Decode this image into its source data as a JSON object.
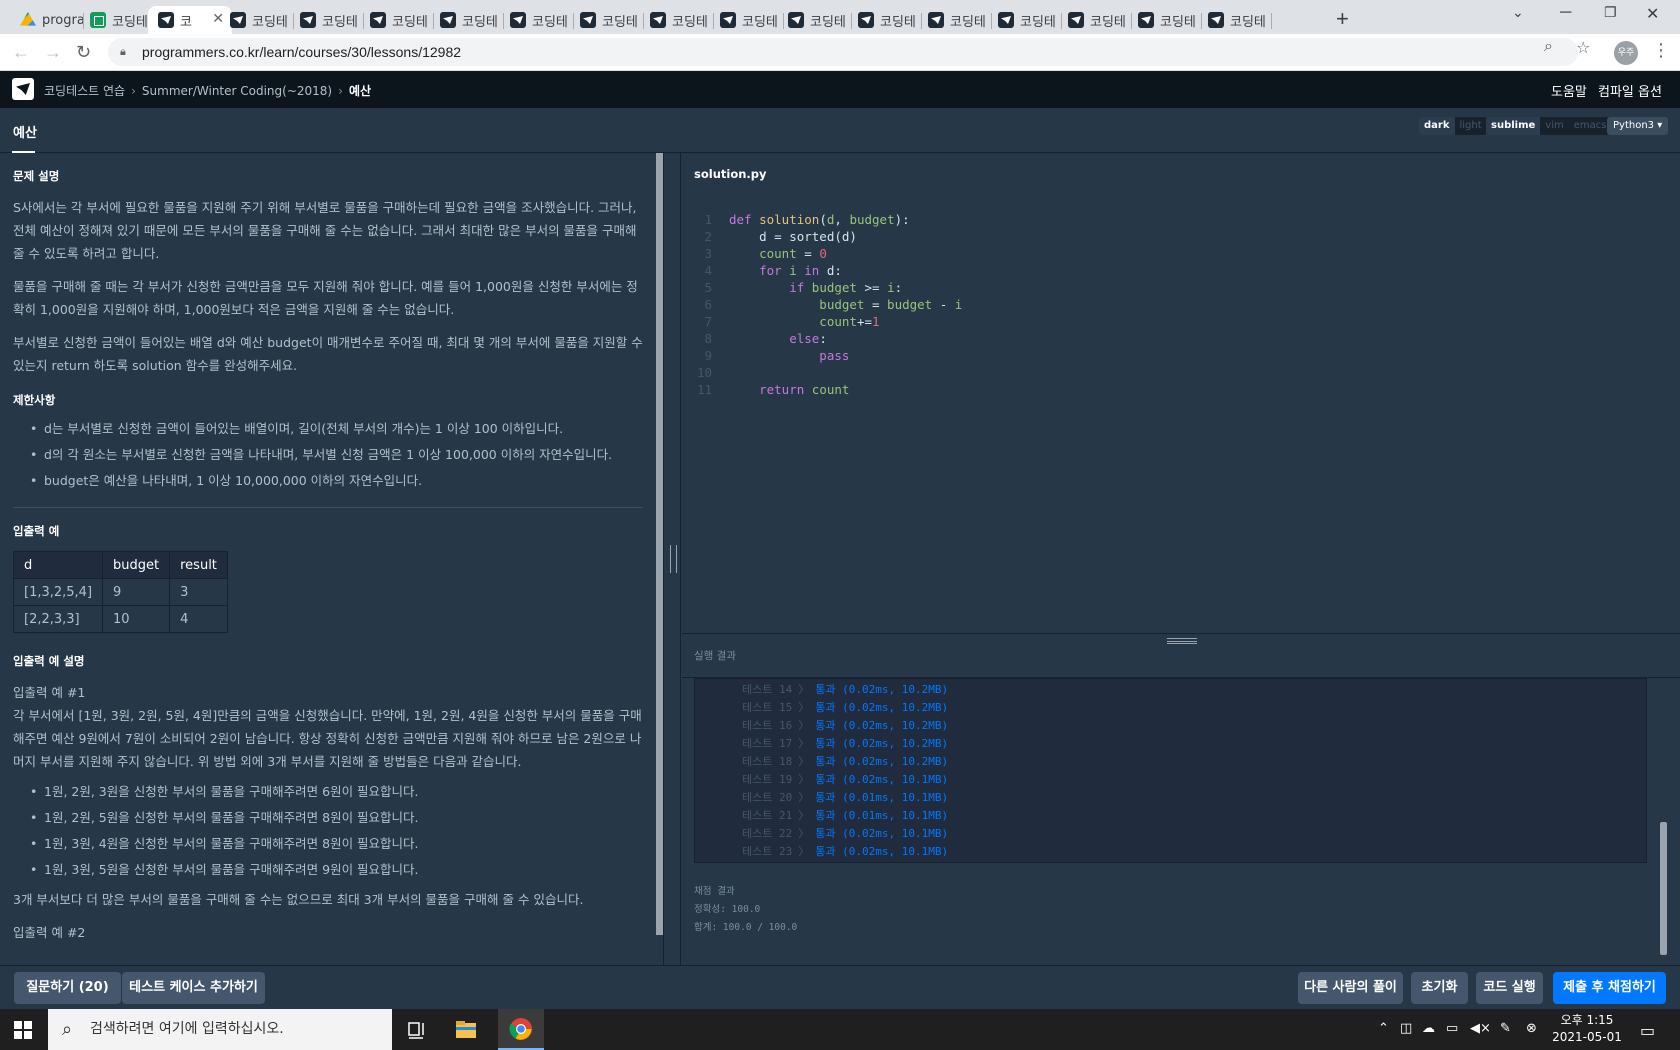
{
  "browser": {
    "tabs": [
      {
        "label": "progra",
        "icon": "drive"
      },
      {
        "label": "코딩테",
        "icon": "sheet"
      },
      {
        "label": "코",
        "icon": "pg",
        "active": true
      },
      {
        "label": "코딩테",
        "icon": "pg"
      },
      {
        "label": "코딩테",
        "icon": "pg"
      },
      {
        "label": "코딩테",
        "icon": "pg"
      },
      {
        "label": "코딩테",
        "icon": "pg"
      },
      {
        "label": "코딩테",
        "icon": "pg"
      },
      {
        "label": "코딩테",
        "icon": "pg"
      },
      {
        "label": "코딩테",
        "icon": "pg"
      },
      {
        "label": "코딩테",
        "icon": "pg"
      },
      {
        "label": "코딩테",
        "icon": "pg"
      },
      {
        "label": "코딩테",
        "icon": "pg"
      },
      {
        "label": "코딩테",
        "icon": "pg"
      },
      {
        "label": "코딩테",
        "icon": "pg"
      },
      {
        "label": "코딩테",
        "icon": "pg"
      },
      {
        "label": "코딩테",
        "icon": "pg"
      },
      {
        "label": "코딩테",
        "icon": "pg"
      }
    ],
    "url": "programmers.co.kr/learn/courses/30/lessons/12982",
    "profile": "우주"
  },
  "site": {
    "breadcrumbs": [
      "코딩테스트 연습",
      "Summer/Winter Coding(~2018)",
      "예산"
    ],
    "help": "도움말",
    "compile_options": "컴파일 옵션"
  },
  "header": {
    "title": "예산",
    "theme": [
      "dark",
      "light"
    ],
    "keymap": [
      "sublime",
      "vim",
      "emacs"
    ],
    "language": "Python3"
  },
  "problem": {
    "desc_title": "문제 설명",
    "desc": [
      "S사에서는 각 부서에 필요한 물품을 지원해 주기 위해 부서별로 물품을 구매하는데 필요한 금액을 조사했습니다. 그러나, 전체 예산이 정해져 있기 때문에 모든 부서의 물품을 구매해 줄 수는 없습니다. 그래서 최대한 많은 부서의 물품을 구매해 줄 수 있도록 하려고 합니다.",
      "물품을 구매해 줄 때는 각 부서가 신청한 금액만큼을 모두 지원해 줘야 합니다. 예를 들어 1,000원을 신청한 부서에는 정확히 1,000원을 지원해야 하며, 1,000원보다 적은 금액을 지원해 줄 수는 없습니다.",
      "부서별로 신청한 금액이 들어있는 배열 d와 예산 budget이 매개변수로 주어질 때, 최대 몇 개의 부서에 물품을 지원할 수 있는지 return 하도록 solution 함수를 완성해주세요."
    ],
    "constraints_title": "제한사항",
    "constraints": [
      "d는 부서별로 신청한 금액이 들어있는 배열이며, 길이(전체 부서의 개수)는 1 이상 100 이하입니다.",
      "d의 각 원소는 부서별로 신청한 금액을 나타내며, 부서별 신청 금액은 1 이상 100,000 이하의 자연수입니다.",
      "budget은 예산을 나타내며, 1 이상 10,000,000 이하의 자연수입니다."
    ],
    "io_title": "입출력 예",
    "io_headers": [
      "d",
      "budget",
      "result"
    ],
    "io_rows": [
      [
        "[1,3,2,5,4]",
        "9",
        "3"
      ],
      [
        "[2,2,3,3]",
        "10",
        "4"
      ]
    ],
    "explain_title": "입출력 예 설명",
    "example1_title": "입출력 예 #1",
    "example1_text": "각 부서에서 [1원, 3원, 2원, 5원, 4원]만큼의 금액을 신청했습니다. 만약에, 1원, 2원, 4원을 신청한 부서의 물품을 구매해주면 예산 9원에서 7원이 소비되어 2원이 남습니다. 항상 정확히 신청한 금액만큼 지원해 줘야 하므로 남은 2원으로 나머지 부서를 지원해 주지 않습니다. 위 방법 외에 3개 부서를 지원해 줄 방법들은 다음과 같습니다.",
    "example1_list": [
      "1원, 2원, 3원을 신청한 부서의 물품을 구매해주려면 6원이 필요합니다.",
      "1원, 2원, 5원을 신청한 부서의 물품을 구매해주려면 8원이 필요합니다.",
      "1원, 3원, 4원을 신청한 부서의 물품을 구매해주려면 8원이 필요합니다.",
      "1원, 3원, 5원을 신청한 부서의 물품을 구매해주려면 9원이 필요합니다."
    ],
    "example1_conclusion": "3개 부서보다 더 많은 부서의 물품을 구매해 줄 수는 없으므로 최대 3개 부서의 물품을 구매해 줄 수 있습니다.",
    "example2_title": "입출력 예 #2"
  },
  "editor": {
    "filename": "solution.py",
    "lines": [
      [
        [
          "kw",
          "def "
        ],
        [
          "fn",
          "solution"
        ],
        [
          "tx",
          "("
        ],
        [
          "pm",
          "d"
        ],
        [
          "tx",
          ", "
        ],
        [
          "pm",
          "budget"
        ],
        [
          "tx",
          "):"
        ]
      ],
      [
        [
          "tx",
          "    d = sorted(d)"
        ]
      ],
      [
        [
          "vr",
          "    count"
        ],
        [
          "tx",
          " = "
        ],
        [
          "nm",
          "0"
        ]
      ],
      [
        [
          "kw",
          "    for "
        ],
        [
          "vr",
          "i"
        ],
        [
          "kw",
          " in "
        ],
        [
          "tx",
          "d:"
        ]
      ],
      [
        [
          "kw",
          "        if "
        ],
        [
          "vr",
          "budget"
        ],
        [
          "tx",
          " >= "
        ],
        [
          "vr",
          "i"
        ],
        [
          "tx",
          ":"
        ]
      ],
      [
        [
          "vr",
          "            budget"
        ],
        [
          "tx",
          " = "
        ],
        [
          "vr",
          "budget"
        ],
        [
          "tx",
          " - "
        ],
        [
          "vr",
          "i"
        ]
      ],
      [
        [
          "vr",
          "            count"
        ],
        [
          "tx",
          "+="
        ],
        [
          "nm",
          "1"
        ]
      ],
      [
        [
          "kw",
          "        else"
        ],
        [
          "tx",
          ":"
        ]
      ],
      [
        [
          "kw",
          "            pass"
        ]
      ],
      [
        [
          "tx",
          ""
        ]
      ],
      [
        [
          "kw",
          "    return "
        ],
        [
          "vr",
          "count"
        ]
      ]
    ]
  },
  "output": {
    "title": "실행 결과",
    "test_label": "테스트",
    "results": [
      {
        "n": "14",
        "text": "통과 (0.02ms, 10.2MB)"
      },
      {
        "n": "15",
        "text": "통과 (0.02ms, 10.2MB)"
      },
      {
        "n": "16",
        "text": "통과 (0.02ms, 10.2MB)"
      },
      {
        "n": "17",
        "text": "통과 (0.02ms, 10.2MB)"
      },
      {
        "n": "18",
        "text": "통과 (0.02ms, 10.2MB)"
      },
      {
        "n": "19",
        "text": "통과 (0.02ms, 10.1MB)"
      },
      {
        "n": "20",
        "text": "통과 (0.01ms, 10.1MB)"
      },
      {
        "n": "21",
        "text": "통과 (0.01ms, 10.1MB)"
      },
      {
        "n": "22",
        "text": "통과 (0.02ms, 10.1MB)"
      },
      {
        "n": "23",
        "text": "통과 (0.02ms, 10.1MB)"
      }
    ],
    "grade_title": "채점 결과",
    "accuracy": "정확성: 100.0",
    "total": "합계: 100.0 / 100.0"
  },
  "actions": {
    "questions": "질문하기 (20)",
    "add_testcase": "테스트 케이스 추가하기",
    "others": "다른 사람의 풀이",
    "reset": "초기화",
    "run": "코드 실행",
    "submit": "제출 후 채점하기"
  },
  "taskbar": {
    "search_placeholder": "검색하려면 여기에 입력하십시오.",
    "time": "오후 1:15",
    "date": "2021-05-01"
  }
}
